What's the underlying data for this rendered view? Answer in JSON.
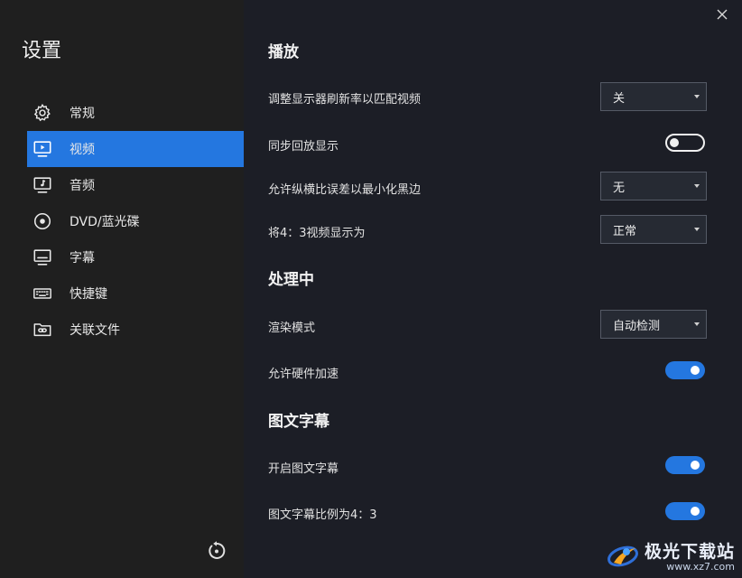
{
  "sidebar": {
    "title": "设置",
    "items": [
      {
        "label": "常规",
        "icon": "gear-icon"
      },
      {
        "label": "视频",
        "icon": "monitor-play-icon",
        "active": true
      },
      {
        "label": "音频",
        "icon": "monitor-music-icon"
      },
      {
        "label": "DVD/蓝光碟",
        "icon": "disc-icon"
      },
      {
        "label": "字幕",
        "icon": "subtitle-icon"
      },
      {
        "label": "快捷键",
        "icon": "keyboard-icon"
      },
      {
        "label": "关联文件",
        "icon": "folder-link-icon"
      }
    ],
    "reset_icon": "reset-icon"
  },
  "sections": {
    "playback": {
      "title": "播放",
      "refresh_label": "调整显示器刷新率以匹配视频",
      "refresh_value": "关",
      "sync_label": "同步回放显示",
      "sync_on": false,
      "aspect_label": "允许纵横比误差以最小化黑边",
      "aspect_value": "无",
      "ratio_label": "将4：3视频显示为",
      "ratio_value": "正常"
    },
    "processing": {
      "title": "处理中",
      "render_label": "渲染模式",
      "render_value": "自动检测",
      "hw_label": "允许硬件加速",
      "hw_on": true
    },
    "subtitles": {
      "title": "图文字幕",
      "enable_label": "开启图文字幕",
      "enable_on": true,
      "ratio_label": "图文字幕比例为4：3",
      "ratio_on": true
    }
  },
  "colors": {
    "accent": "#2477e0",
    "sidebar_bg": "#1f1f1f",
    "main_bg": "#1c1e26"
  },
  "watermark": {
    "name": "极光下载站",
    "url": "www.xz7.com"
  }
}
